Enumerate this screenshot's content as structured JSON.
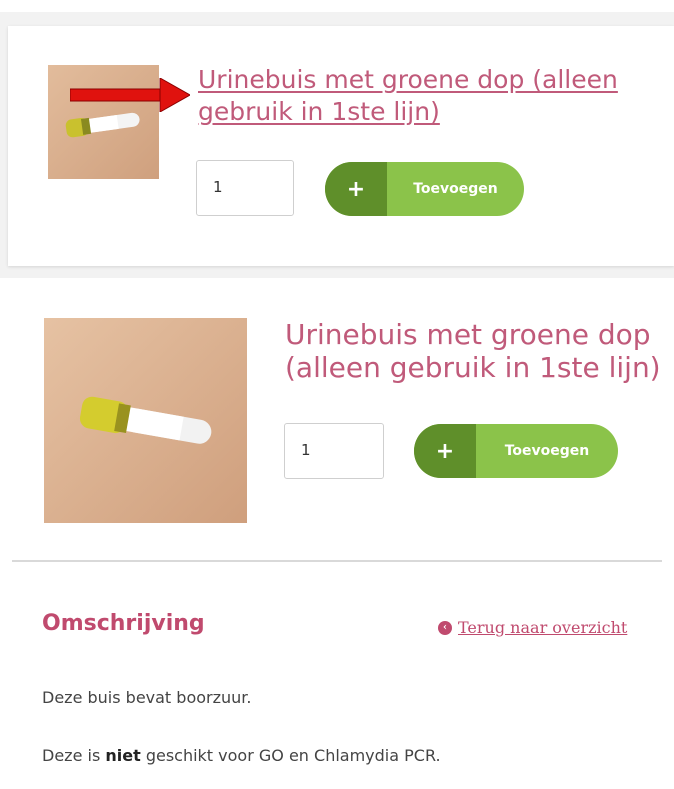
{
  "product": {
    "title": "Urinebuis met groene dop (alleen gebruik in 1ste lijn)",
    "quantity": "1",
    "add_plus": "+",
    "add_label": "Toevoegen"
  },
  "description": {
    "heading": "Omschrijving",
    "back_link": "Terug naar overzicht",
    "line1": "Deze buis bevat boorzuur.",
    "line2_prefix": "Deze is ",
    "line2_bold": "niet",
    "line2_suffix": " geschikt voor GO en Chlamydia PCR."
  },
  "colors": {
    "title": "#c05a7a",
    "button_dark": "#5f8f2a",
    "button_light": "#8bc34a",
    "annotation_arrow": "#e0120e"
  }
}
